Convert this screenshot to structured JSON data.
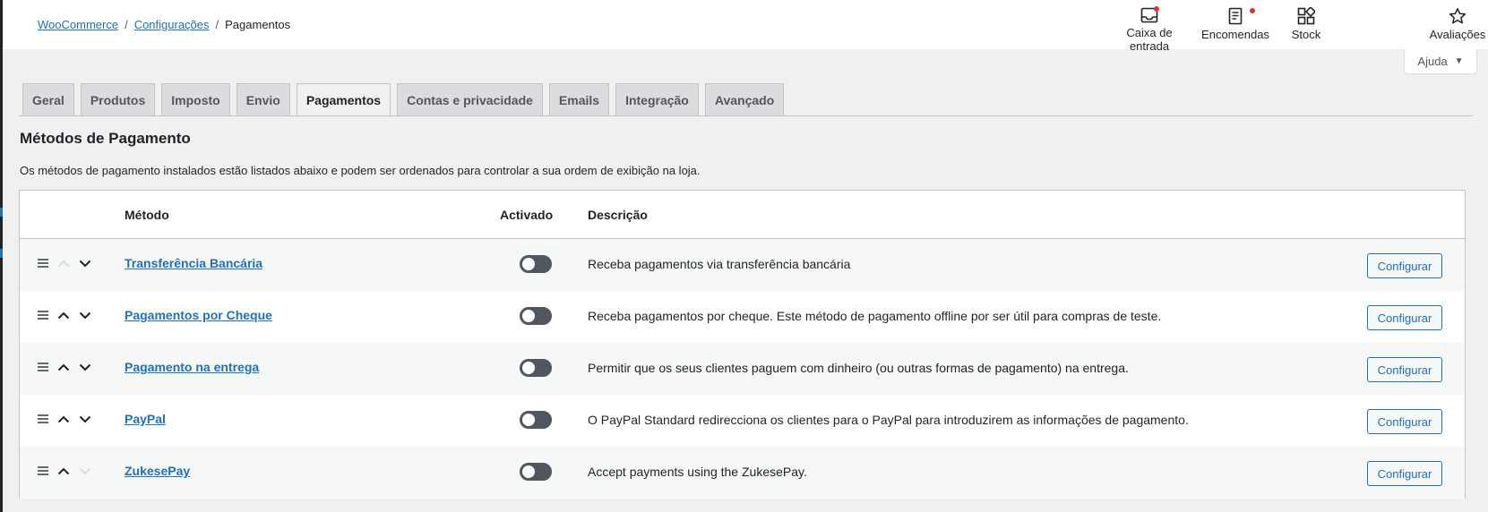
{
  "breadcrumb": {
    "items": [
      {
        "label": "WooCommerce"
      },
      {
        "label": "Configurações"
      }
    ],
    "separator": "/",
    "current": "Pagamentos"
  },
  "activity": {
    "inbox": {
      "label_line1": "Caixa de",
      "label_line2": "entrada",
      "icon": "inbox-icon",
      "has_notification": true
    },
    "orders": {
      "label": "Encomendas",
      "icon": "orders-icon",
      "has_notification": true
    },
    "stock": {
      "label": "Stock",
      "icon": "stock-icon"
    },
    "reviews": {
      "label": "Avaliações",
      "icon": "star-icon"
    }
  },
  "help": {
    "label": "Ajuda",
    "caret": "▼"
  },
  "tabs": [
    {
      "label": "Geral",
      "active": false
    },
    {
      "label": "Produtos",
      "active": false
    },
    {
      "label": "Imposto",
      "active": false
    },
    {
      "label": "Envio",
      "active": false
    },
    {
      "label": "Pagamentos",
      "active": true
    },
    {
      "label": "Contas e privacidade",
      "active": false
    },
    {
      "label": "Emails",
      "active": false
    },
    {
      "label": "Integração",
      "active": false
    },
    {
      "label": "Avançado",
      "active": false
    }
  ],
  "section": {
    "title": "Métodos de Pagamento",
    "description": "Os métodos de pagamento instalados estão listados abaixo e podem ser ordenados para controlar a sua ordem de exibição na loja."
  },
  "table": {
    "headers": {
      "method": "Método",
      "enabled": "Activado",
      "description": "Descrição"
    },
    "rows": [
      {
        "name": "Transferência Bancária",
        "enabled": false,
        "description": "Receba pagamentos via transferência bancária",
        "action": "Configurar",
        "can_move_up": false,
        "can_move_down": true
      },
      {
        "name": "Pagamentos por Cheque",
        "enabled": false,
        "description": "Receba pagamentos por cheque. Este método de pagamento offline por ser útil para compras de teste.",
        "action": "Configurar",
        "can_move_up": true,
        "can_move_down": true
      },
      {
        "name": "Pagamento na entrega",
        "enabled": false,
        "description": "Permitir que os seus clientes paguem com dinheiro (ou outras formas de pagamento) na entrega.",
        "action": "Configurar",
        "can_move_up": true,
        "can_move_down": true
      },
      {
        "name": "PayPal",
        "enabled": false,
        "description": "O PayPal Standard redirecciona os clientes para o PayPal para introduzirem as informações de pagamento.",
        "action": "Configurar",
        "can_move_up": true,
        "can_move_down": true
      },
      {
        "name": "ZukesePay",
        "enabled": false,
        "description": "Accept payments using the ZukesePay.",
        "action": "Configurar",
        "can_move_up": true,
        "can_move_down": false
      }
    ]
  },
  "colors": {
    "link": "#2271b1",
    "notification": "#d63638",
    "toggle_off": "#50575e"
  }
}
